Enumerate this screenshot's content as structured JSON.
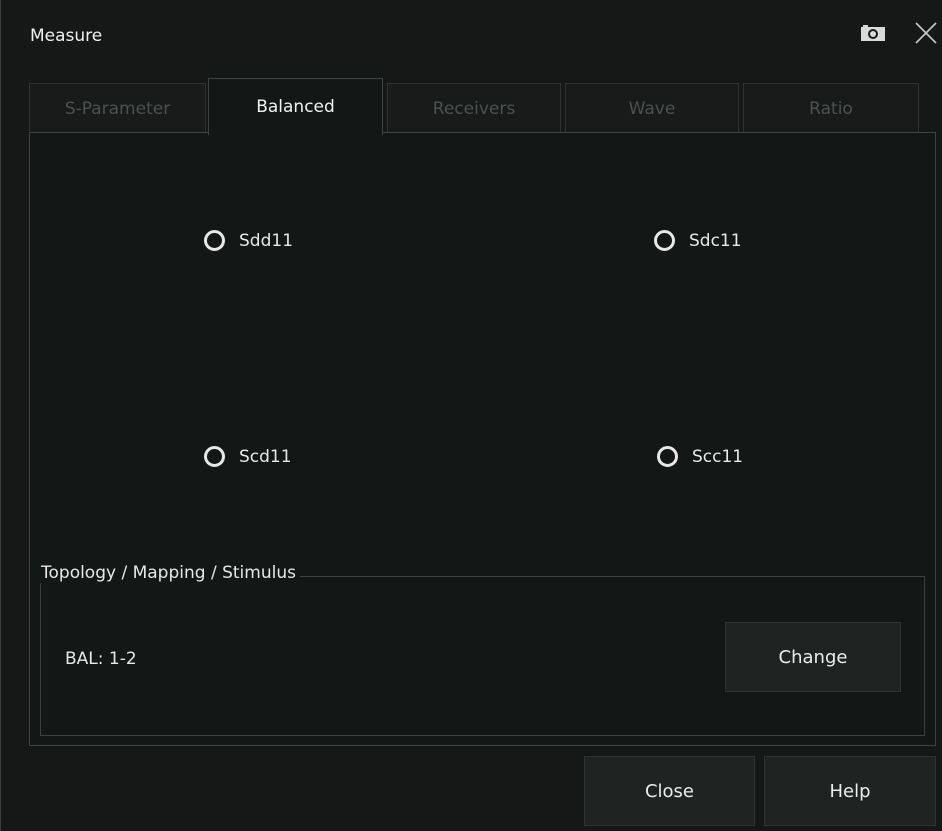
{
  "dialog": {
    "title": "Measure"
  },
  "tabs": [
    {
      "label": "S-Parameter",
      "active": false
    },
    {
      "label": "Balanced",
      "active": true
    },
    {
      "label": "Receivers",
      "active": false
    },
    {
      "label": "Wave",
      "active": false
    },
    {
      "label": "Ratio",
      "active": false
    }
  ],
  "options": [
    {
      "label": "Sdd11",
      "selected": false
    },
    {
      "label": "Sdc11",
      "selected": false
    },
    {
      "label": "Scd11",
      "selected": false
    },
    {
      "label": "Scc11",
      "selected": false
    }
  ],
  "topology": {
    "group_title": "Topology / Mapping / Stimulus",
    "value": "BAL: 1-2",
    "change_label": "Change"
  },
  "footer": {
    "close_label": "Close",
    "help_label": "Help"
  },
  "icons": {
    "camera": "camera-icon",
    "close": "close-icon"
  }
}
